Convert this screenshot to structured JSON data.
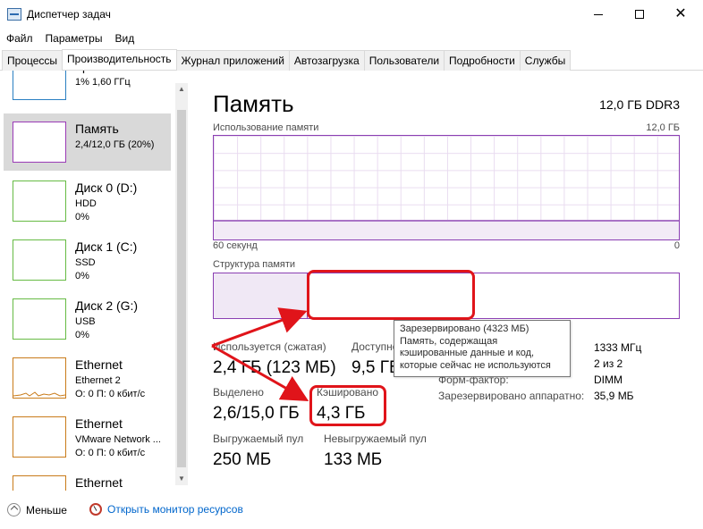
{
  "window": {
    "title": "Диспетчер задач",
    "controls": {
      "minimize": "",
      "maximize": "",
      "close": "✕"
    }
  },
  "menu": [
    "Файл",
    "Параметры",
    "Вид"
  ],
  "tabs": [
    "Процессы",
    "Производительность",
    "Журнал приложений",
    "Автозагрузка",
    "Пользователи",
    "Подробности",
    "Службы"
  ],
  "active_tab": "Производительность",
  "sidebar": {
    "items": [
      {
        "title": "ЦП",
        "sub1": "1% 1,60 ГГц",
        "sub2": "",
        "kind": "cpu"
      },
      {
        "title": "Память",
        "sub1": "2,4/12,0 ГБ (20%)",
        "sub2": "",
        "kind": "mem",
        "selected": true
      },
      {
        "title": "Диск 0 (D:)",
        "sub1": "HDD",
        "sub2": "0%",
        "kind": "disk"
      },
      {
        "title": "Диск 1 (C:)",
        "sub1": "SSD",
        "sub2": "0%",
        "kind": "disk"
      },
      {
        "title": "Диск 2 (G:)",
        "sub1": "USB",
        "sub2": "0%",
        "kind": "disk"
      },
      {
        "title": "Ethernet",
        "sub1": "Ethernet 2",
        "sub2": "О: 0 П: 0 кбит/с",
        "kind": "net"
      },
      {
        "title": "Ethernet",
        "sub1": "VMware Network ...",
        "sub2": "О: 0 П: 0 кбит/с",
        "kind": "net"
      },
      {
        "title": "Ethernet",
        "sub1": "",
        "sub2": "",
        "kind": "net"
      }
    ]
  },
  "main": {
    "title": "Память",
    "spec": "12,0 ГБ DDR3",
    "usage_label": "Использование памяти",
    "usage_max": "12,0 ГБ",
    "axis_left": "60 секунд",
    "axis_right": "0",
    "structure_label": "Структура памяти",
    "stats": {
      "used_label": "Используется (сжатая)",
      "used_value": "2,4 ГБ (123 МБ)",
      "avail_label": "Доступно",
      "avail_value": "9,5 ГБ",
      "committed_label": "Выделено",
      "committed_value": "2,6/15,0 ГБ",
      "cached_label": "Кэшировано",
      "cached_value": "4,3 ГБ",
      "paged_label": "Выгружаемый пул",
      "paged_value": "250 МБ",
      "nonpaged_label": "Невыгружаемый пул",
      "nonpaged_value": "133 МБ"
    },
    "specs": {
      "speed_value": "1333 МГц",
      "slots_value": "2 из 2",
      "form_label": "Форм-фактор:",
      "form_value": "DIMM",
      "reserved_label": "Зарезервировано аппаратно:",
      "reserved_value": "35,9 МБ"
    }
  },
  "tooltip": {
    "line1": "Зарезервировано (4323 МБ)",
    "line2": "Память, содержащая",
    "line3": "кэшированные данные и код,",
    "line4": "которые сейчас не используются"
  },
  "footer": {
    "fewer": "Меньше",
    "monitor": "Открыть монитор ресурсов"
  },
  "colors": {
    "memory_accent": "#8b3fb3",
    "annotation_red": "#e0141a",
    "link": "#0066cc"
  }
}
